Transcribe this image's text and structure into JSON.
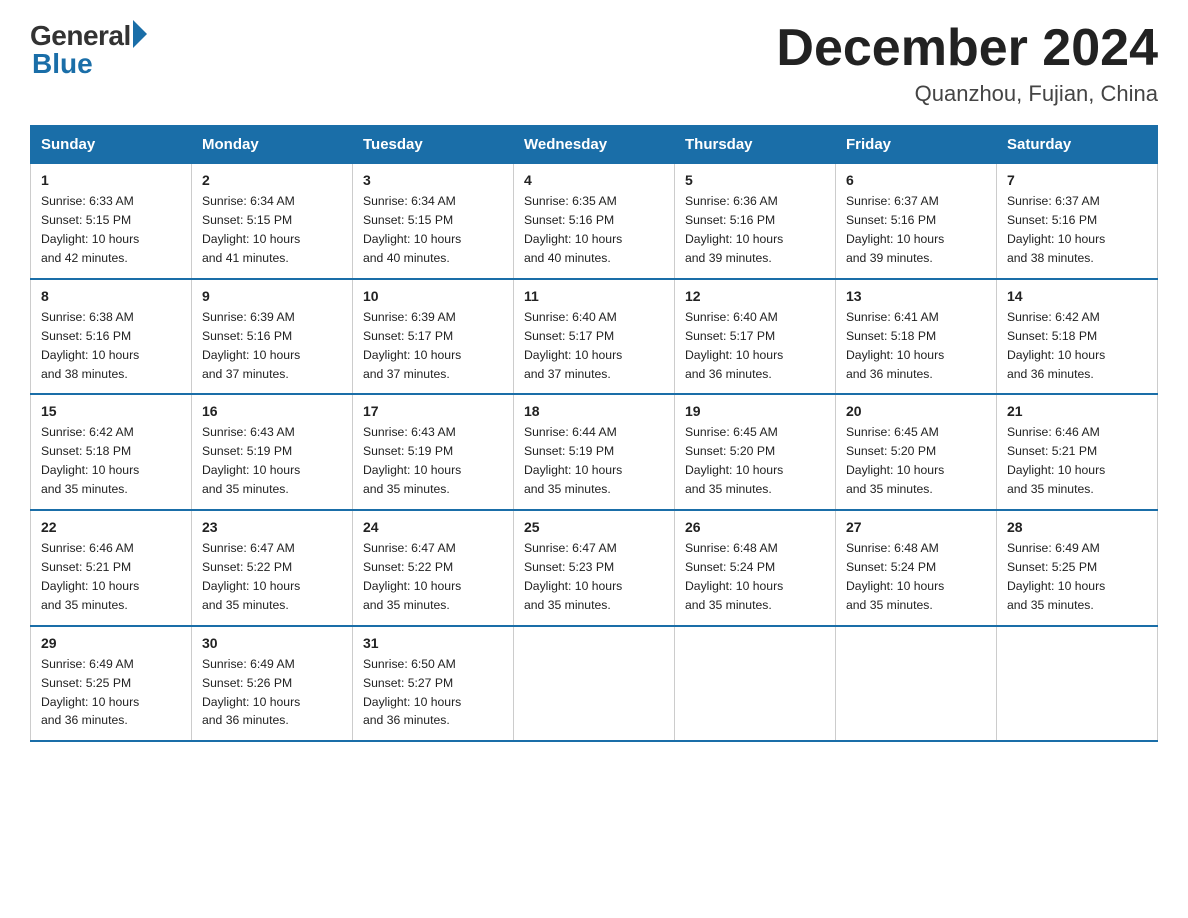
{
  "header": {
    "logo_general": "General",
    "logo_blue": "Blue",
    "title": "December 2024",
    "location": "Quanzhou, Fujian, China"
  },
  "weekdays": [
    "Sunday",
    "Monday",
    "Tuesday",
    "Wednesday",
    "Thursday",
    "Friday",
    "Saturday"
  ],
  "weeks": [
    [
      {
        "day": "1",
        "sunrise": "6:33 AM",
        "sunset": "5:15 PM",
        "daylight": "10 hours and 42 minutes."
      },
      {
        "day": "2",
        "sunrise": "6:34 AM",
        "sunset": "5:15 PM",
        "daylight": "10 hours and 41 minutes."
      },
      {
        "day": "3",
        "sunrise": "6:34 AM",
        "sunset": "5:15 PM",
        "daylight": "10 hours and 40 minutes."
      },
      {
        "day": "4",
        "sunrise": "6:35 AM",
        "sunset": "5:16 PM",
        "daylight": "10 hours and 40 minutes."
      },
      {
        "day": "5",
        "sunrise": "6:36 AM",
        "sunset": "5:16 PM",
        "daylight": "10 hours and 39 minutes."
      },
      {
        "day": "6",
        "sunrise": "6:37 AM",
        "sunset": "5:16 PM",
        "daylight": "10 hours and 39 minutes."
      },
      {
        "day": "7",
        "sunrise": "6:37 AM",
        "sunset": "5:16 PM",
        "daylight": "10 hours and 38 minutes."
      }
    ],
    [
      {
        "day": "8",
        "sunrise": "6:38 AM",
        "sunset": "5:16 PM",
        "daylight": "10 hours and 38 minutes."
      },
      {
        "day": "9",
        "sunrise": "6:39 AM",
        "sunset": "5:16 PM",
        "daylight": "10 hours and 37 minutes."
      },
      {
        "day": "10",
        "sunrise": "6:39 AM",
        "sunset": "5:17 PM",
        "daylight": "10 hours and 37 minutes."
      },
      {
        "day": "11",
        "sunrise": "6:40 AM",
        "sunset": "5:17 PM",
        "daylight": "10 hours and 37 minutes."
      },
      {
        "day": "12",
        "sunrise": "6:40 AM",
        "sunset": "5:17 PM",
        "daylight": "10 hours and 36 minutes."
      },
      {
        "day": "13",
        "sunrise": "6:41 AM",
        "sunset": "5:18 PM",
        "daylight": "10 hours and 36 minutes."
      },
      {
        "day": "14",
        "sunrise": "6:42 AM",
        "sunset": "5:18 PM",
        "daylight": "10 hours and 36 minutes."
      }
    ],
    [
      {
        "day": "15",
        "sunrise": "6:42 AM",
        "sunset": "5:18 PM",
        "daylight": "10 hours and 35 minutes."
      },
      {
        "day": "16",
        "sunrise": "6:43 AM",
        "sunset": "5:19 PM",
        "daylight": "10 hours and 35 minutes."
      },
      {
        "day": "17",
        "sunrise": "6:43 AM",
        "sunset": "5:19 PM",
        "daylight": "10 hours and 35 minutes."
      },
      {
        "day": "18",
        "sunrise": "6:44 AM",
        "sunset": "5:19 PM",
        "daylight": "10 hours and 35 minutes."
      },
      {
        "day": "19",
        "sunrise": "6:45 AM",
        "sunset": "5:20 PM",
        "daylight": "10 hours and 35 minutes."
      },
      {
        "day": "20",
        "sunrise": "6:45 AM",
        "sunset": "5:20 PM",
        "daylight": "10 hours and 35 minutes."
      },
      {
        "day": "21",
        "sunrise": "6:46 AM",
        "sunset": "5:21 PM",
        "daylight": "10 hours and 35 minutes."
      }
    ],
    [
      {
        "day": "22",
        "sunrise": "6:46 AM",
        "sunset": "5:21 PM",
        "daylight": "10 hours and 35 minutes."
      },
      {
        "day": "23",
        "sunrise": "6:47 AM",
        "sunset": "5:22 PM",
        "daylight": "10 hours and 35 minutes."
      },
      {
        "day": "24",
        "sunrise": "6:47 AM",
        "sunset": "5:22 PM",
        "daylight": "10 hours and 35 minutes."
      },
      {
        "day": "25",
        "sunrise": "6:47 AM",
        "sunset": "5:23 PM",
        "daylight": "10 hours and 35 minutes."
      },
      {
        "day": "26",
        "sunrise": "6:48 AM",
        "sunset": "5:24 PM",
        "daylight": "10 hours and 35 minutes."
      },
      {
        "day": "27",
        "sunrise": "6:48 AM",
        "sunset": "5:24 PM",
        "daylight": "10 hours and 35 minutes."
      },
      {
        "day": "28",
        "sunrise": "6:49 AM",
        "sunset": "5:25 PM",
        "daylight": "10 hours and 35 minutes."
      }
    ],
    [
      {
        "day": "29",
        "sunrise": "6:49 AM",
        "sunset": "5:25 PM",
        "daylight": "10 hours and 36 minutes."
      },
      {
        "day": "30",
        "sunrise": "6:49 AM",
        "sunset": "5:26 PM",
        "daylight": "10 hours and 36 minutes."
      },
      {
        "day": "31",
        "sunrise": "6:50 AM",
        "sunset": "5:27 PM",
        "daylight": "10 hours and 36 minutes."
      },
      null,
      null,
      null,
      null
    ]
  ],
  "labels": {
    "sunrise": "Sunrise:",
    "sunset": "Sunset:",
    "daylight": "Daylight:"
  }
}
